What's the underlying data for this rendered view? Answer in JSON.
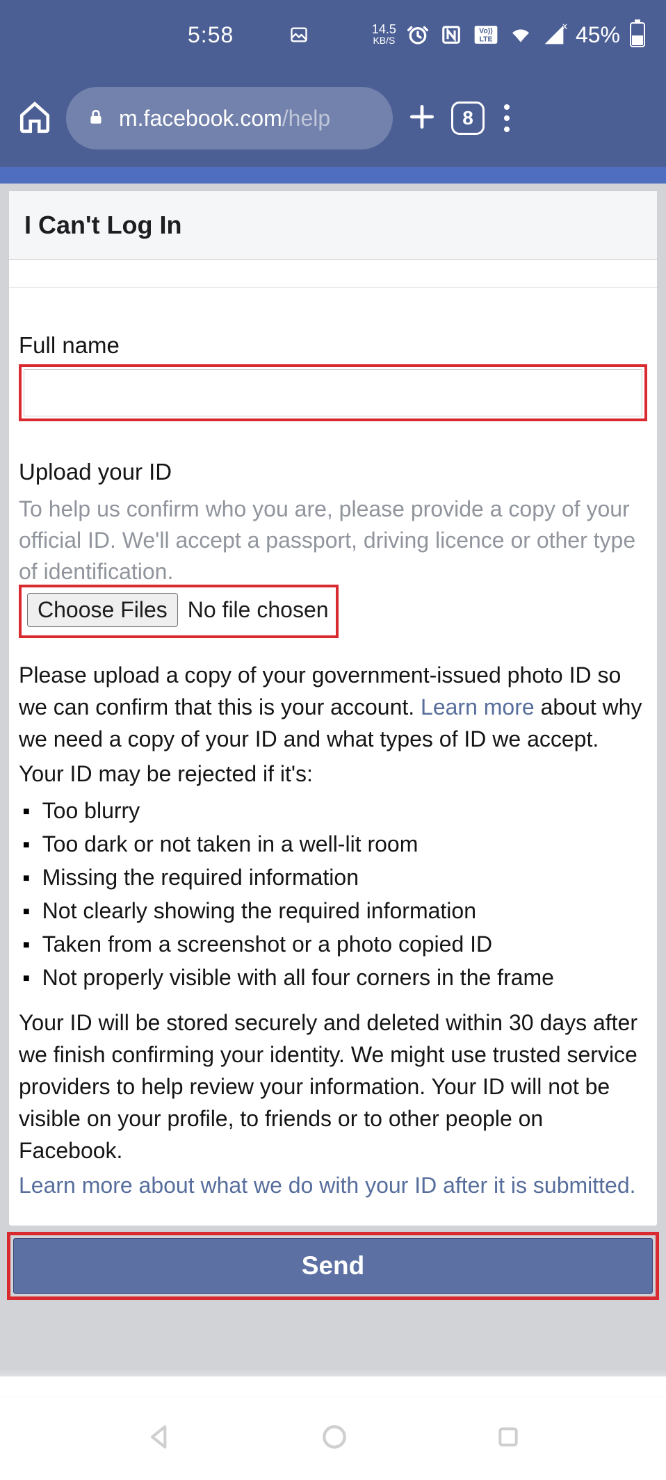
{
  "status": {
    "time": "5:58",
    "net_speed_top": "14.5",
    "net_speed_bot": "KB/S",
    "volte": "Vo))\nLTE",
    "battery_pct": "45%"
  },
  "browser": {
    "url_domain": "m.facebook.com",
    "url_path": "/help",
    "tab_count": "8"
  },
  "page": {
    "title": "I Can't Log In",
    "full_name_label": "Full name",
    "full_name_value": "",
    "upload_label": "Upload your ID",
    "upload_help": "To help us confirm who you are, please provide a copy of your official ID. We'll accept a passport, driving licence or other type of identification.",
    "choose_files_btn": "Choose Files",
    "no_file_text": "No file chosen",
    "para1_a": "Please upload a copy of your government-issued photo ID so we can confirm that this is your account. ",
    "para1_link": "Learn more",
    "para1_b": " about why we need a copy of your ID and what types of ID we accept.",
    "rejected_intro": "Your ID may be rejected if it's:",
    "rejections": [
      "Too blurry",
      "Too dark or not taken in a well-lit room",
      "Missing the required information",
      "Not clearly showing the required information",
      "Taken from a screenshot or a photo copied ID",
      "Not properly visible with all four corners in the frame"
    ],
    "para2": "Your ID will be stored securely and deleted within 30 days after we finish confirming your identity. We might use trusted service providers to help review your information. Your ID will not be visible on your profile, to friends or to other people on Facebook.",
    "para2_link": "Learn more about what we do with your ID after it is submitted.",
    "send_btn": "Send"
  }
}
